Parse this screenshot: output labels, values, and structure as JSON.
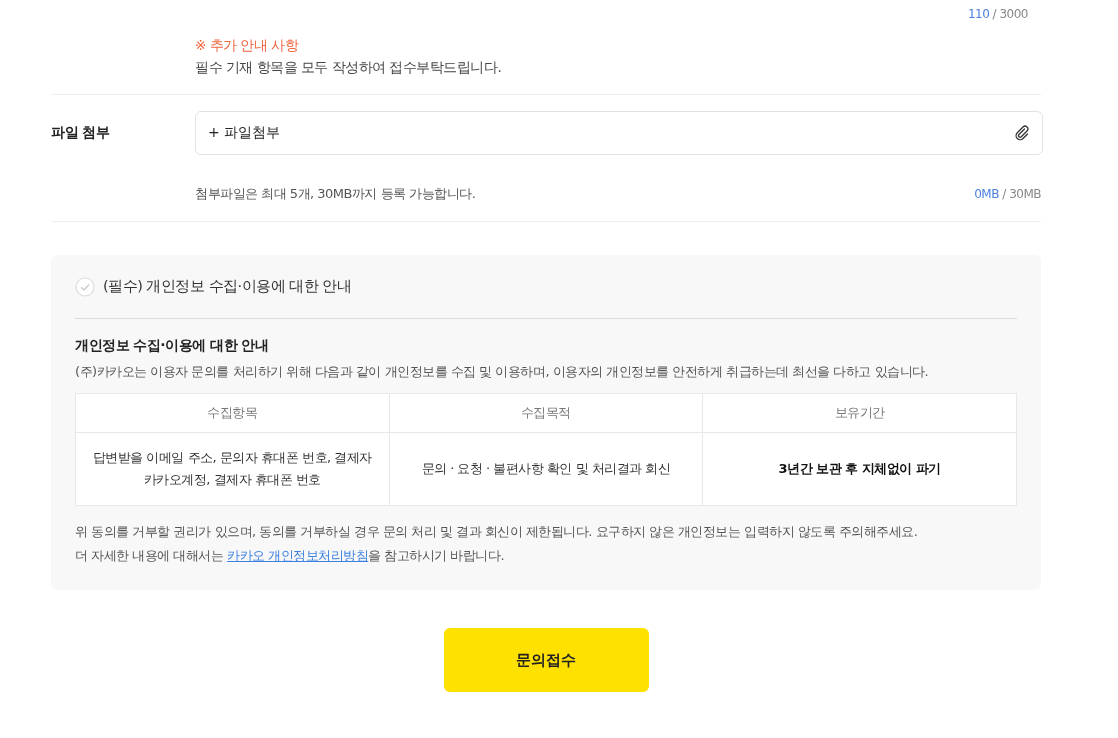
{
  "message_counter": {
    "current": "110",
    "max": "/ 3000"
  },
  "notice": {
    "title": "※ 추가 안내 사항",
    "text": "필수 기재 항목을 모두 작성하여 접수부탁드립니다."
  },
  "attachment": {
    "label": "파일 첨부",
    "button": "+ 파일첨부",
    "hint": "첨부파일은 최대 5개, 30MB까지 등록 가능합니다.",
    "used": "0MB",
    "max": "/ 30MB"
  },
  "consent": {
    "checked": false,
    "label": "(필수) 개인정보 수집·이용에 대한 안내",
    "heading": "개인정보 수집·이용에 대한 안내",
    "intro": "(주)카카오는 이용자 문의를 처리하기 위해 다음과 같이 개인정보를 수집 및 이용하며, 이용자의 개인정보를 안전하게 취급하는데 최선을 다하고 있습니다.",
    "table": {
      "columns": [
        "수집항목",
        "수집목적",
        "보유기간"
      ],
      "rows": [
        [
          {
            "text": "답변받을 이메일 주소, 문의자 휴대폰 번호, 결제자 카카오계정, 결제자 휴대폰 번호",
            "strong": false
          },
          {
            "text": "문의 · 요청 · 불편사항 확인 및 처리결과 회신",
            "strong": false
          },
          {
            "text": "3년간 보관 후 지체없이 파기",
            "strong": true
          }
        ]
      ]
    },
    "notice": "위 동의를 거부할 권리가 있으며, 동의를 거부하실 경우 문의 처리 및 결과 회신이 제한됩니다. 요구하지 않은 개인정보는 입력하지 않도록 주의해주세요.",
    "policy": {
      "before": "더 자세한 내용에 대해서는 ",
      "link": "카카오 개인정보처리방침",
      "after": "을 참고하시기 바랍니다."
    }
  },
  "submit": "문의접수"
}
